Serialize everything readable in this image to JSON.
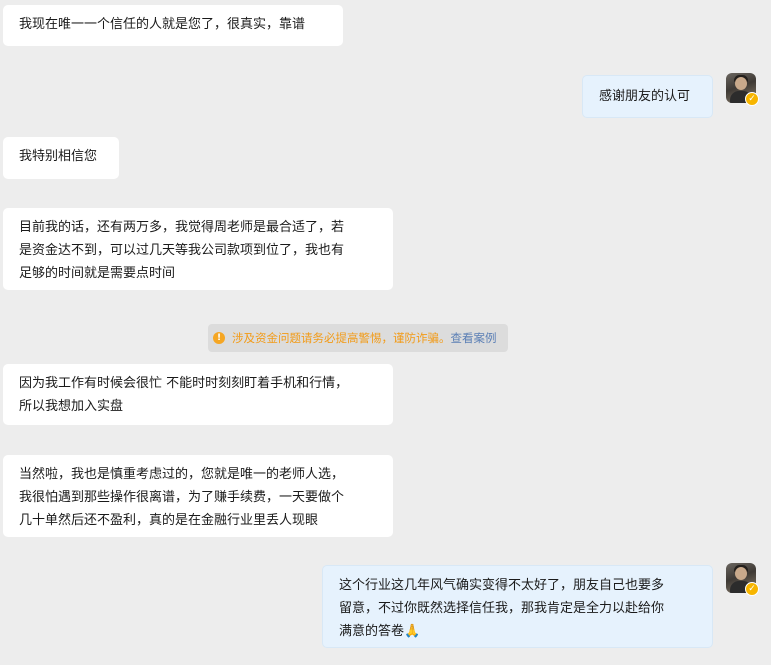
{
  "messages": [
    {
      "side": "left",
      "text": "我现在唯一一个信任的人就是您了，很真实，靠谱"
    },
    {
      "side": "right",
      "text": "感谢朋友的认可"
    },
    {
      "side": "left",
      "text": "我特别相信您"
    },
    {
      "side": "left",
      "text": "目前我的话，还有两万多，我觉得周老师是最合适了，若\n是资金达不到，可以过几天等我公司款项到位了，我也有\n足够的时间就是需要点时间"
    },
    {
      "side": "left",
      "text": "因为我工作有时候会很忙 不能时时刻刻盯着手机和行情，\n所以我想加入实盘"
    },
    {
      "side": "left",
      "text": "当然啦，我也是慎重考虑过的，您就是唯一的老师人选，\n我很怕遇到那些操作很离谱，为了赚手续费，一天要做个\n几十单然后还不盈利，真的是在金融行业里丢人现眼"
    },
    {
      "side": "right",
      "text": "这个行业这几年风气确实变得不太好了，朋友自己也要多\n留意，不过你既然选择信任我，那我肯定是全力以赴给你\n满意的答卷🙏"
    }
  ],
  "notice": {
    "icon": "warning-icon",
    "text": "涉及资金问题请务必提高警惕，谨防诈骗。",
    "link": "查看案例"
  },
  "avatar": {
    "icon": "user-avatar",
    "badge_icon": "verified-badge-icon",
    "badge_color": "#f7b500"
  }
}
